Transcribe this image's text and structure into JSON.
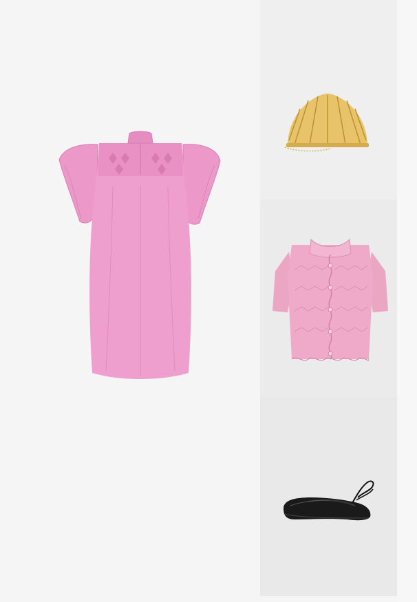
{
  "outfit": {
    "main_item": {
      "icon": "pink-smocked-flutter-sleeve-dress-image"
    },
    "side_items": [
      {
        "icon": "gold-shell-clutch-image"
      },
      {
        "icon": "pink-knit-scalloped-cardigan-image"
      },
      {
        "icon": "black-lace-up-ballet-flat-image"
      }
    ]
  },
  "colors": {
    "background": "#f5f5f5",
    "tile_background": "#ececec",
    "dress_pink": "#ee9fcd",
    "cardigan_pink": "#eba6c4",
    "gold": "#e8c36a",
    "shoe_black": "#1a1a1a"
  }
}
